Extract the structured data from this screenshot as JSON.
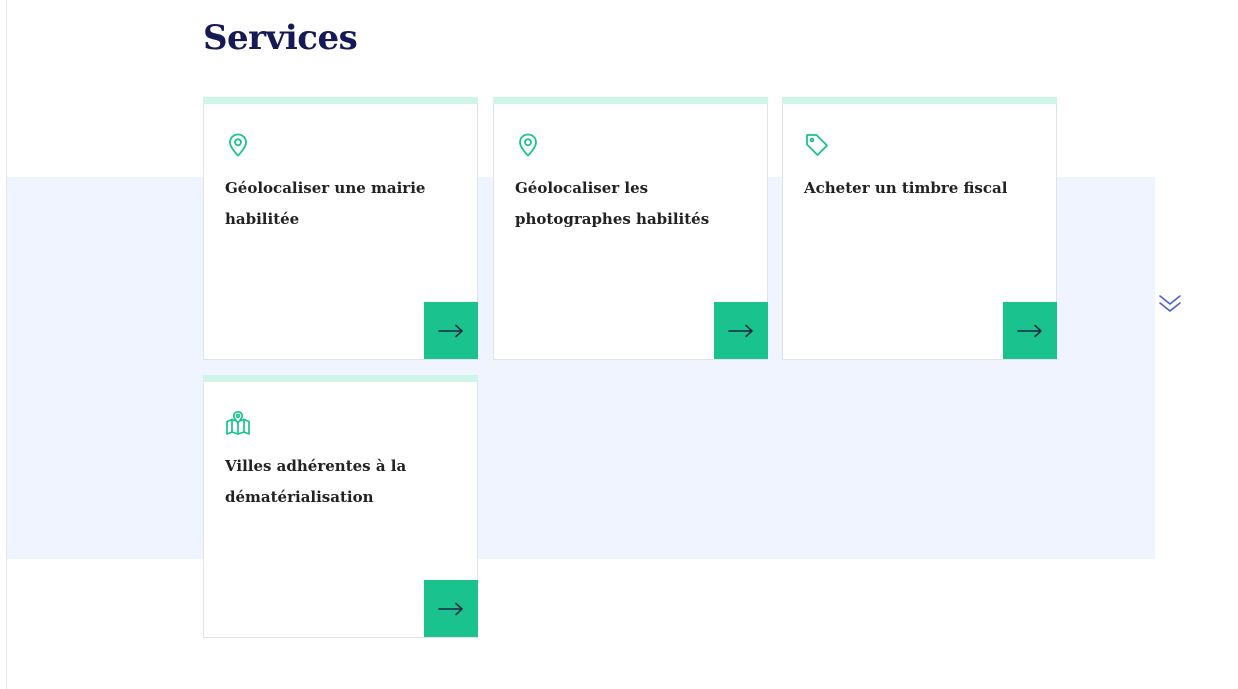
{
  "services": {
    "title": "Services",
    "cards": [
      {
        "label": "Géolocaliser une mairie habilitée",
        "icon": "map-pin-icon",
        "action_icon": "arrow-right-icon"
      },
      {
        "label": "Géolocaliser les photographes habilités",
        "icon": "map-pin-icon",
        "action_icon": "arrow-right-icon"
      },
      {
        "label": "Acheter un timbre fiscal",
        "icon": "price-tag-icon",
        "action_icon": "arrow-right-icon"
      },
      {
        "label": "Villes adhérentes à la dématérialisation",
        "icon": "folded-map-icon",
        "action_icon": "arrow-right-icon"
      }
    ]
  },
  "scroll_indicator": {
    "icon": "double-chevron-down-icon"
  },
  "colors": {
    "title": "#161a54",
    "accent_green": "#1ac38d",
    "card_top_bar": "#cff5e9",
    "band_background": "#f0f4fe",
    "chevron": "#4d5fd0"
  }
}
